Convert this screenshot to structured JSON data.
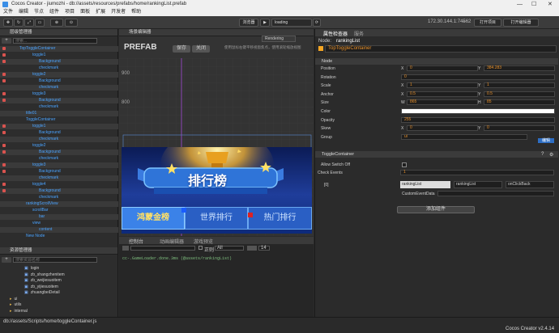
{
  "window": {
    "title": "Cocos Creator - jiumozhi - db://assets/resources/prefabs/home/rankingList.prefab",
    "minimize": "—",
    "maximize": "☐",
    "close": "✕"
  },
  "menu": [
    "文件",
    "编辑",
    "节点",
    "组件",
    "项目",
    "面板",
    "扩展",
    "开发者",
    "帮助"
  ],
  "toolbar": {
    "preview_mode": "浏览器",
    "play": "▶",
    "scene_select": "loading",
    "ip": "172.30.144.1:7456",
    "wifi": "2",
    "project_btn": "打开项目",
    "editor_btn": "打开编辑器"
  },
  "hierarchy": {
    "title": "层级管理器",
    "search_placeholder": "搜索...",
    "rows": [
      {
        "label": "TopToggleContainer",
        "indent": 0,
        "lock": true,
        "color": "blue"
      },
      {
        "label": "toggle1",
        "indent": 2,
        "lock": true,
        "color": "blue"
      },
      {
        "label": "Background",
        "indent": 3,
        "lock": true,
        "color": "blue"
      },
      {
        "label": "checkmark",
        "indent": 3,
        "lock": false,
        "color": "blue"
      },
      {
        "label": "toggle2",
        "indent": 2,
        "lock": true,
        "color": "blue"
      },
      {
        "label": "Background",
        "indent": 3,
        "lock": true,
        "color": "blue"
      },
      {
        "label": "checkmark",
        "indent": 3,
        "lock": false,
        "color": "blue"
      },
      {
        "label": "toggle3",
        "indent": 2,
        "lock": true,
        "color": "blue"
      },
      {
        "label": "Background",
        "indent": 3,
        "lock": true,
        "color": "blue"
      },
      {
        "label": "checkmark",
        "indent": 3,
        "lock": false,
        "color": "blue"
      },
      {
        "label": "title01",
        "indent": 1,
        "lock": false,
        "color": "blue"
      },
      {
        "label": "ToggleContainer",
        "indent": 1,
        "lock": false,
        "color": "blue"
      },
      {
        "label": "toggle1",
        "indent": 2,
        "lock": true,
        "color": "blue"
      },
      {
        "label": "Background",
        "indent": 3,
        "lock": true,
        "color": "blue"
      },
      {
        "label": "checkmark",
        "indent": 3,
        "lock": false,
        "color": "blue"
      },
      {
        "label": "toggle2",
        "indent": 2,
        "lock": true,
        "color": "blue"
      },
      {
        "label": "Background",
        "indent": 3,
        "lock": true,
        "color": "blue"
      },
      {
        "label": "checkmark",
        "indent": 3,
        "lock": false,
        "color": "blue"
      },
      {
        "label": "toggle3",
        "indent": 2,
        "lock": true,
        "color": "blue"
      },
      {
        "label": "Background",
        "indent": 3,
        "lock": true,
        "color": "blue"
      },
      {
        "label": "checkmark",
        "indent": 3,
        "lock": false,
        "color": "blue"
      },
      {
        "label": "toggle4",
        "indent": 2,
        "lock": true,
        "color": "blue"
      },
      {
        "label": "Background",
        "indent": 3,
        "lock": true,
        "color": "blue"
      },
      {
        "label": "checkmark",
        "indent": 3,
        "lock": false,
        "color": "blue"
      },
      {
        "label": "rankingScrollView",
        "indent": 1,
        "lock": false,
        "color": "blue"
      },
      {
        "label": "scrollBar",
        "indent": 2,
        "lock": false,
        "color": "blue"
      },
      {
        "label": "bar",
        "indent": 3,
        "lock": false,
        "color": "blue"
      },
      {
        "label": "view",
        "indent": 2,
        "lock": false,
        "color": "blue"
      },
      {
        "label": "content",
        "indent": 3,
        "lock": false,
        "color": "blue"
      },
      {
        "label": "New Node",
        "indent": 1,
        "lock": false,
        "color": "blue"
      }
    ]
  },
  "assets": {
    "title": "资源管理器",
    "search_placeholder": "搜索资源名称",
    "items": [
      "login",
      "zb_shangzhenitem",
      "zb_weijiesuoitem",
      "zb_yijiesuoitem",
      "zhuangbeiDetail",
      "ui",
      "utils",
      "internal"
    ]
  },
  "scene": {
    "title": "场景编辑器",
    "prefab_label": "PREFAB",
    "save": "保存",
    "close": "关闭",
    "hint": "使用鼠标右键平移视窗焦点，使用滚轮缩放视图",
    "rendering": "Rendering",
    "y_labels": [
      "900",
      "800",
      "700",
      "600"
    ],
    "banner_title": "排行榜",
    "tabs": [
      "鸿蒙金榜",
      "世界排行",
      "热门排行"
    ]
  },
  "console": {
    "tabs": [
      "控制台",
      "动画编辑器",
      "游戏预览"
    ],
    "regex": "正则",
    "level": "All",
    "font": "14",
    "log": "cc-.GameLoader.done.3ms (@assets/rankingList)"
  },
  "inspector": {
    "tabs": [
      "属性检查器",
      "服务"
    ],
    "node_name": "rankingList",
    "node_prefix": "Node:",
    "child_name": "TopToggleContainer",
    "node_section": "Node",
    "props": [
      {
        "label": "Position",
        "x": "0",
        "y": "384.283"
      },
      {
        "label": "Rotation",
        "v": "0"
      },
      {
        "label": "Scale",
        "x": "1",
        "y": "1"
      },
      {
        "label": "Anchor",
        "x": "0.5",
        "y": "0.5"
      },
      {
        "label": "Size",
        "x": "865",
        "y": "85"
      },
      {
        "label": "Color",
        "v": ""
      },
      {
        "label": "Opacity",
        "v": "255"
      },
      {
        "label": "Skew",
        "x": "0",
        "y": "0"
      },
      {
        "label": "Group",
        "v": "ui"
      }
    ],
    "edit_btn": "编辑",
    "toggle_section": "ToggleContainer",
    "allow_switch": "Allow Switch Off",
    "check_events": "Check Events",
    "check_events_count": "1",
    "event_index": "[0]",
    "event_node": "rankingList",
    "event_component": "rankingList",
    "event_handler": "onClickBack",
    "custom_data_label": "CustomEventData",
    "add_component": "添加组件"
  },
  "status": {
    "path": "db://assets/Scripts/home/toggleContainer.js",
    "version": "Cocos Creator v2.4.14"
  }
}
